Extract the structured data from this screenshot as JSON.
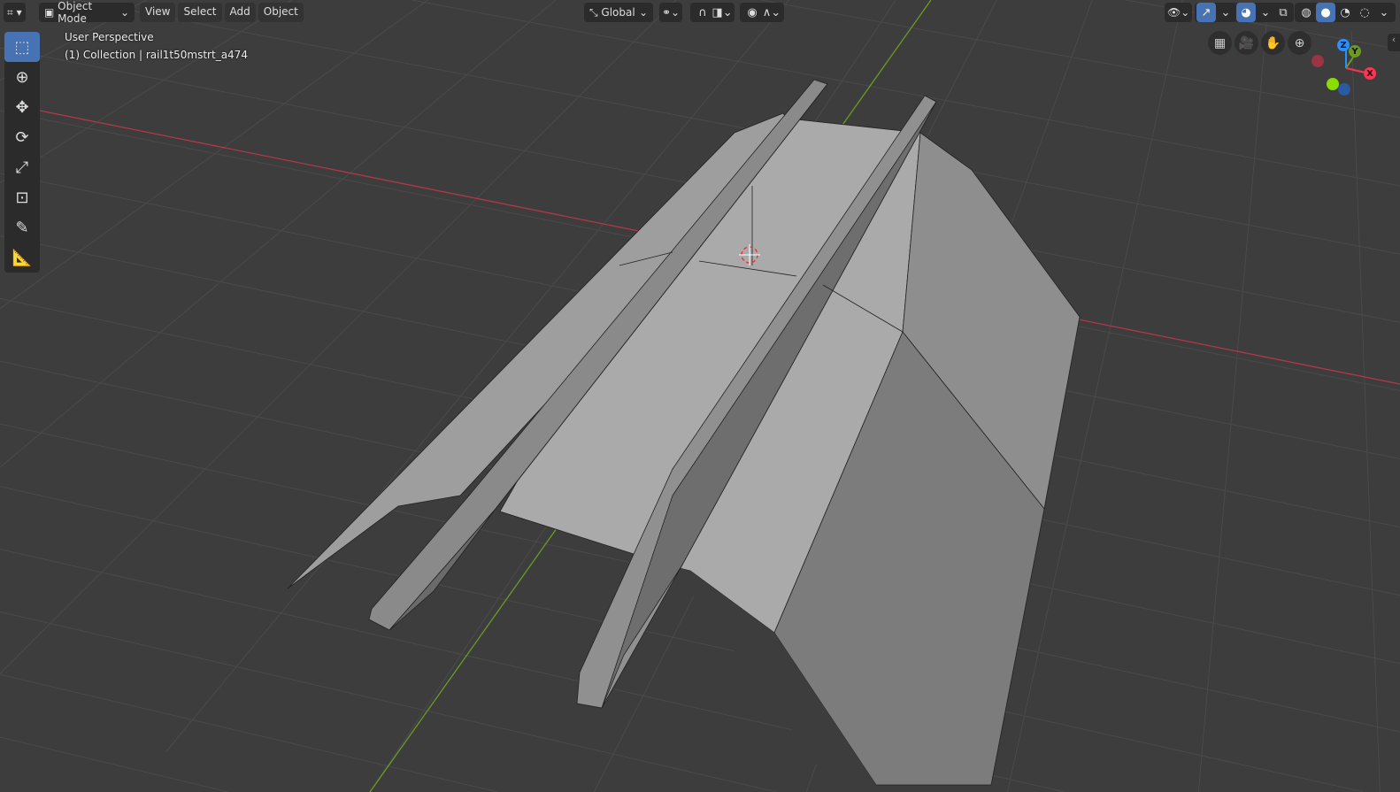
{
  "header": {
    "editor_type_icon": "viewport-icon",
    "mode": "Object Mode",
    "menus": [
      "View",
      "Select",
      "Add",
      "Object"
    ],
    "orientation": "Global"
  },
  "viewport": {
    "view_name": "User Perspective",
    "collection_info": "(1) Collection | rail1t50mstrt_a474"
  },
  "gizmo": {
    "x": "X",
    "y": "Y",
    "z": "Z"
  },
  "colors": {
    "accent": "#4772b3",
    "x_axis": "#ff3352",
    "y_axis": "#8bdc00",
    "z_axis": "#2890ff",
    "background": "#3d3d3d"
  }
}
